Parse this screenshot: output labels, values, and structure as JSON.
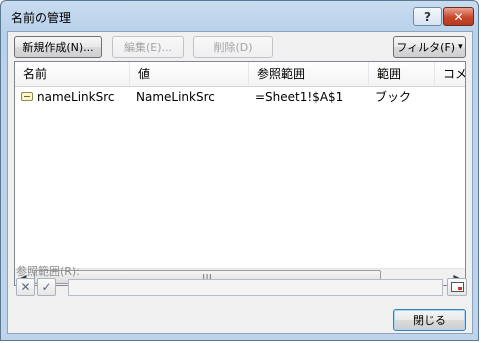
{
  "window": {
    "title": "名前の管理",
    "help_glyph": "?",
    "close_glyph": "✕"
  },
  "toolbar": {
    "new_label": "新規作成(N)...",
    "edit_label": "編集(E)...",
    "delete_label": "削除(D)",
    "filter_label": "フィルタ(F)",
    "filter_arrow": "▾"
  },
  "table": {
    "headers": [
      "名前",
      "値",
      "参照範囲",
      "範囲",
      "コメ"
    ],
    "rows": [
      {
        "name": "nameLinkSrc",
        "value": "NameLinkSrc",
        "refers_to": "=Sheet1!$A$1",
        "scope": "ブック",
        "comment": ""
      }
    ]
  },
  "scrollbar": {
    "left": "◀",
    "right": "▶",
    "grip": "III"
  },
  "reference": {
    "label": "参照範囲(R):",
    "value": "",
    "cancel_glyph": "✕",
    "confirm_glyph": "✓"
  },
  "footer": {
    "close_label": "閉じる"
  }
}
